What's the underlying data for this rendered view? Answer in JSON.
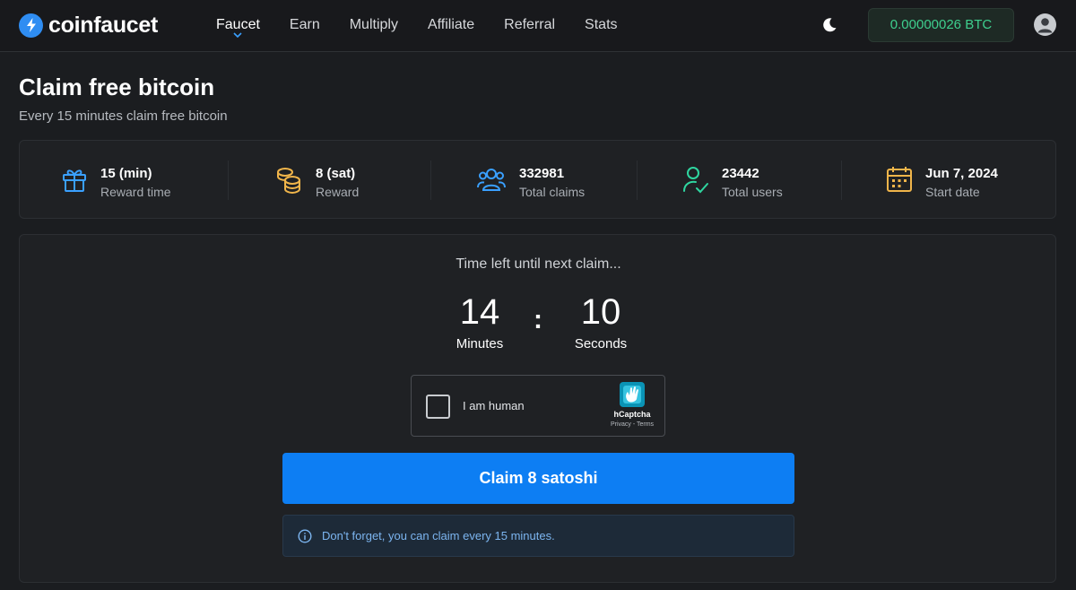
{
  "brand": {
    "name": "coinfaucet",
    "accent": "#0d7ef3"
  },
  "nav": {
    "items": [
      {
        "label": "Faucet",
        "active": true
      },
      {
        "label": "Earn"
      },
      {
        "label": "Multiply"
      },
      {
        "label": "Affiliate"
      },
      {
        "label": "Referral"
      },
      {
        "label": "Stats"
      }
    ]
  },
  "header": {
    "theme_icon": "moon-icon",
    "balance": "0.00000026 BTC",
    "avatar_icon": "user-avatar-icon"
  },
  "page": {
    "title": "Claim free bitcoin",
    "subtitle": "Every 15 minutes claim free bitcoin"
  },
  "stats": [
    {
      "icon": "gift-icon",
      "color": "#3aa0ff",
      "value": "15 (min)",
      "label": "Reward time"
    },
    {
      "icon": "coins-icon",
      "color": "#f0b54a",
      "value": "8 (sat)",
      "label": "Reward"
    },
    {
      "icon": "users-icon",
      "color": "#3aa0ff",
      "value": "332981",
      "label": "Total claims"
    },
    {
      "icon": "user-check-icon",
      "color": "#2fd6a0",
      "value": "23442",
      "label": "Total users"
    },
    {
      "icon": "calendar-icon",
      "color": "#f0b54a",
      "value": "Jun 7, 2024",
      "label": "Start date"
    }
  ],
  "timer": {
    "caption": "Time left until next claim...",
    "minutes": "14",
    "minutes_label": "Minutes",
    "separator": ":",
    "seconds": "10",
    "seconds_label": "Seconds"
  },
  "captcha": {
    "label": "I am human",
    "brand": "hCaptcha",
    "links": "Privacy - Terms"
  },
  "claim_button": {
    "label": "Claim 8 satoshi"
  },
  "info": {
    "text": "Don't forget, you can claim every 15 minutes."
  }
}
